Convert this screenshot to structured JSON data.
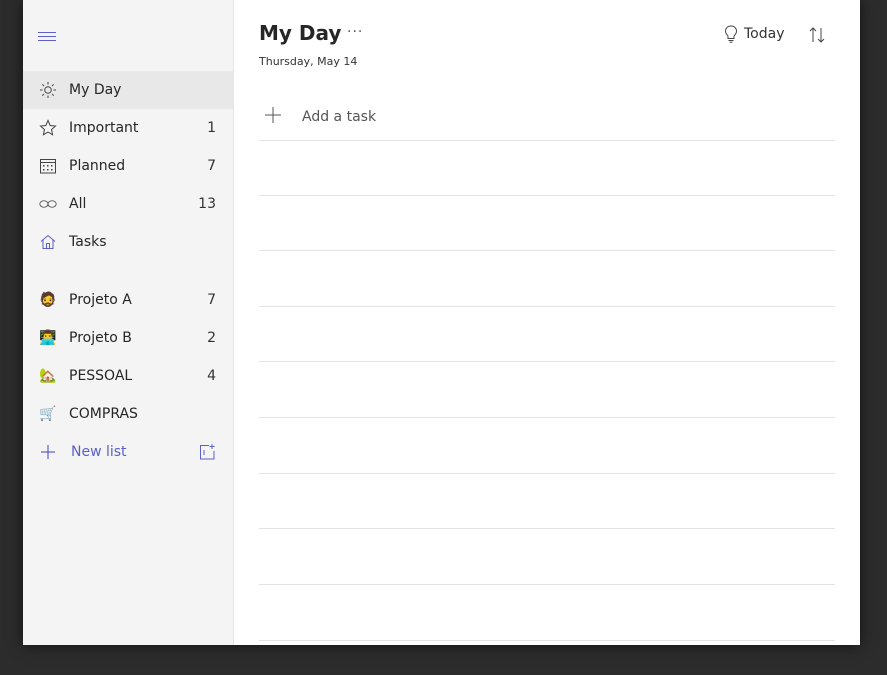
{
  "sidebar": {
    "items": [
      {
        "label": "My Day",
        "count": "",
        "icon": "sun-icon"
      },
      {
        "label": "Important",
        "count": "1",
        "icon": "star-icon"
      },
      {
        "label": "Planned",
        "count": "7",
        "icon": "calendar-icon"
      },
      {
        "label": "All",
        "count": "13",
        "icon": "infinity-icon"
      },
      {
        "label": "Tasks",
        "count": "",
        "icon": "home-icon"
      }
    ],
    "lists": [
      {
        "label": "Projeto A",
        "count": "7",
        "emoji": "🧔"
      },
      {
        "label": "Projeto B",
        "count": "2",
        "emoji": "👨‍💻"
      },
      {
        "label": "PESSOAL",
        "count": "4",
        "emoji": "🏡"
      },
      {
        "label": "COMPRAS",
        "count": "",
        "emoji": "🛒"
      }
    ],
    "new_list_label": "New list"
  },
  "main": {
    "title": "My Day",
    "more_label": "···",
    "date": "Thursday, May 14",
    "today_label": "Today",
    "add_task_placeholder": "Add a task"
  },
  "colors": {
    "accent": "#5b5fc7",
    "sidebar_bg": "#f4f4f4",
    "active_bg": "#e8e8e8"
  }
}
